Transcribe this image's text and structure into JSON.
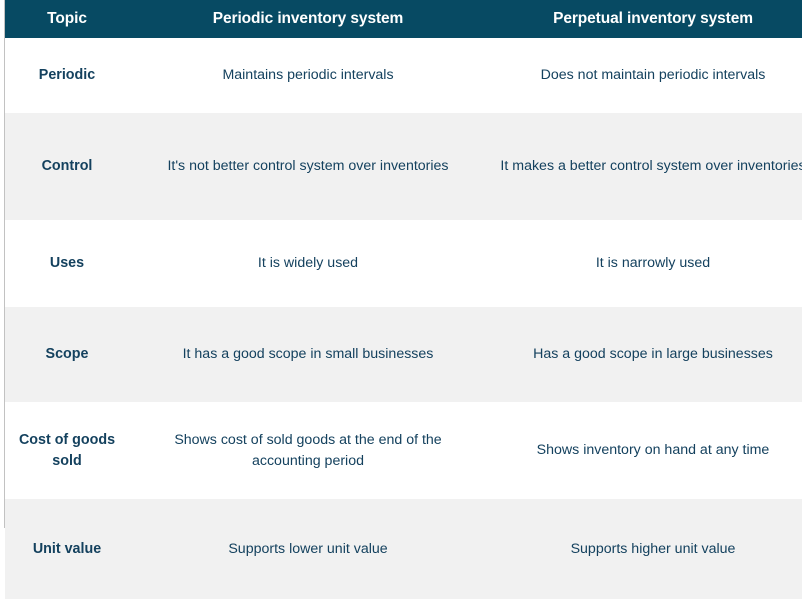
{
  "table": {
    "columns": [
      {
        "key": "topic",
        "label": "Topic"
      },
      {
        "key": "periodic",
        "label": "Periodic inventory system"
      },
      {
        "key": "perpetual",
        "label": "Perpetual inventory system"
      }
    ],
    "rows": [
      {
        "topic": "Periodic",
        "periodic": "Maintains periodic intervals",
        "perpetual": "Does not maintain periodic intervals"
      },
      {
        "topic": "Control",
        "periodic": "It's not better control system over inventories",
        "perpetual": "It makes a better control system over inventories"
      },
      {
        "topic": "Uses",
        "periodic": "It is widely used",
        "perpetual": "It is narrowly used"
      },
      {
        "topic": "Scope",
        "periodic": "It has a good scope in small businesses",
        "perpetual": "Has a good scope in large businesses"
      },
      {
        "topic": "Cost of goods sold",
        "periodic": "Shows cost of sold goods at the end of the accounting period",
        "perpetual": "Shows inventory on hand at any time"
      },
      {
        "topic": "Unit value",
        "periodic": "Supports lower unit value",
        "perpetual": "Supports higher unit value"
      }
    ]
  },
  "colors": {
    "header_background": "#074a63",
    "header_text": "#ffffff",
    "body_text": "#14415e",
    "row_stripe": "#f1f1f1",
    "row_base": "#ffffff",
    "border": "#c2c2c2"
  }
}
